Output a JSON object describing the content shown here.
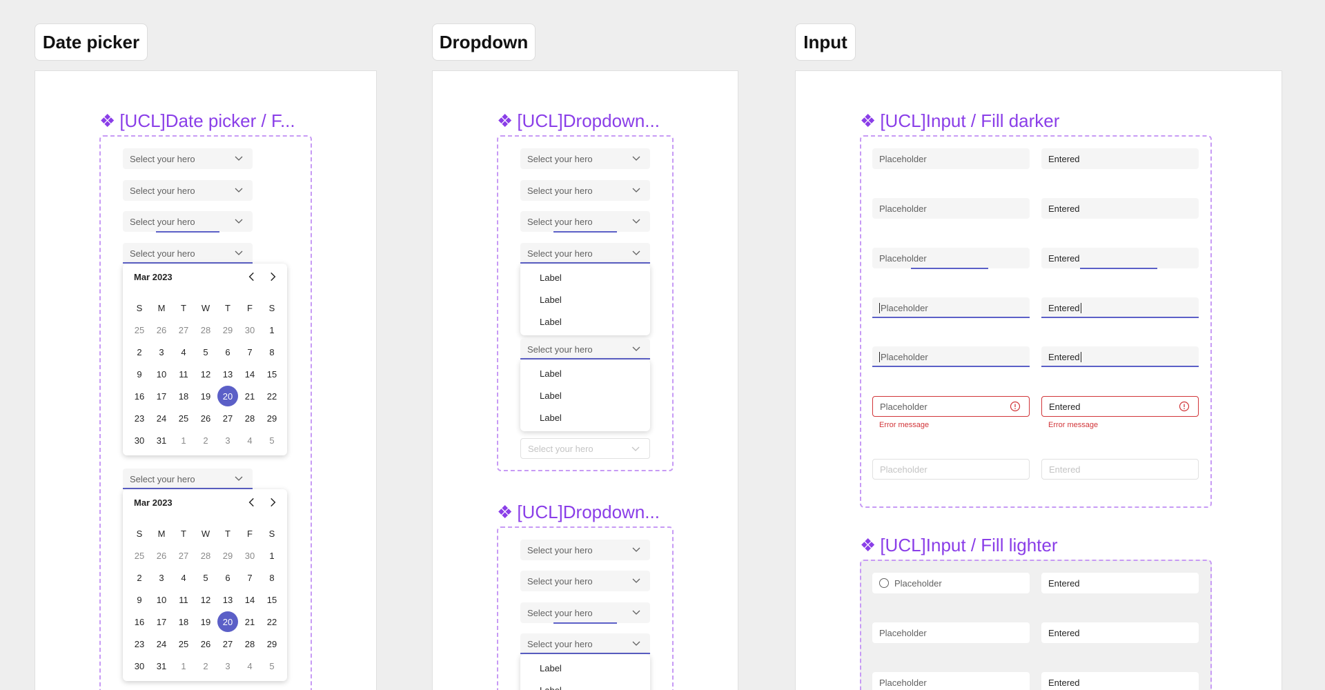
{
  "sections": {
    "date_picker": "Date picker",
    "dropdown": "Dropdown",
    "input": "Input"
  },
  "components": {
    "date_picker_title": "[UCL]Date picker / F...",
    "dropdown_title_1": "[UCL]Dropdown...",
    "dropdown_title_2": "[UCL]Dropdown...",
    "input_dark_title": "[UCL]Input / Fill darker",
    "input_light_title": "[UCL]Input / Fill lighter"
  },
  "dropdown_placeholder": "Select your hero",
  "menu_option": "Label",
  "calendar": {
    "month": "Mar 2023",
    "weekdays": [
      "S",
      "M",
      "T",
      "W",
      "T",
      "F",
      "S"
    ],
    "days": [
      [
        "25",
        "26",
        "27",
        "28",
        "29",
        "30",
        "1"
      ],
      [
        "2",
        "3",
        "4",
        "5",
        "6",
        "7",
        "8"
      ],
      [
        "9",
        "10",
        "11",
        "12",
        "13",
        "14",
        "15"
      ],
      [
        "16",
        "17",
        "18",
        "19",
        "20",
        "21",
        "22"
      ],
      [
        "23",
        "24",
        "25",
        "26",
        "27",
        "28",
        "29"
      ],
      [
        "30",
        "31",
        "1",
        "2",
        "3",
        "4",
        "5"
      ]
    ],
    "selected": "20"
  },
  "input": {
    "placeholder": "Placeholder",
    "entered": "Entered",
    "error_message": "Error message"
  },
  "colors": {
    "brand": "#5b5fc7",
    "component_title": "#8a3ee8",
    "error": "#d13438",
    "dashed_border": "#c79af5"
  }
}
